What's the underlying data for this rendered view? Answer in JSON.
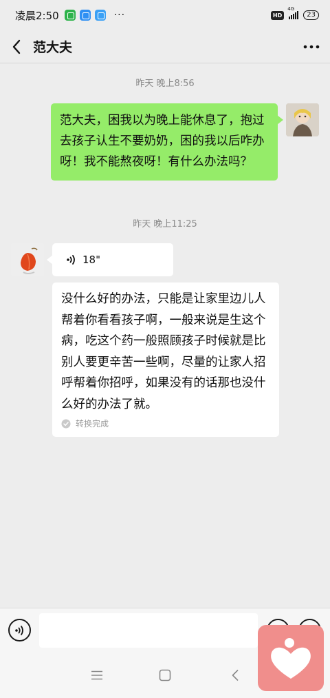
{
  "status_bar": {
    "time": "凌晨2:50",
    "dots": "···",
    "hd": "HD",
    "network": "4G",
    "battery": "23",
    "notification_icons": [
      "app-green-icon",
      "app-blue-icon",
      "app-blue-icon"
    ]
  },
  "header": {
    "title": "范大夫",
    "back_icon": "chevron-left-icon",
    "more_icon": "more-dots-icon"
  },
  "messages": [
    {
      "type": "timestamp",
      "text": "昨天 晚上8:56"
    },
    {
      "type": "text",
      "from": "me",
      "text": "范大夫，困我以为晚上能休息了，抱过去孩子认生不要奶奶，困的我以后咋办呀！我不能熬夜呀！有什么办法吗？"
    },
    {
      "type": "timestamp",
      "text": "昨天 晚上11:25"
    },
    {
      "type": "voice",
      "from": "doctor",
      "duration": "18\""
    },
    {
      "type": "transcript",
      "from": "doctor",
      "text": "没什么好的办法，只能是让家里边儿人帮着你看看孩子啊，一般来说是生这个病，吃这个药一般照顾孩子时候就是比别人要更辛苦一些啊，尽量的让家人招呼帮着你招呼，如果没有的话那也没什么好的办法了就。",
      "status": "转换完成"
    }
  ],
  "input_bar": {
    "placeholder": "",
    "value": ""
  },
  "colors": {
    "outgoing_bubble": "#95ec69",
    "incoming_bubble": "#ffffff",
    "background": "#ededed",
    "floating_app": "#f08e8c"
  }
}
